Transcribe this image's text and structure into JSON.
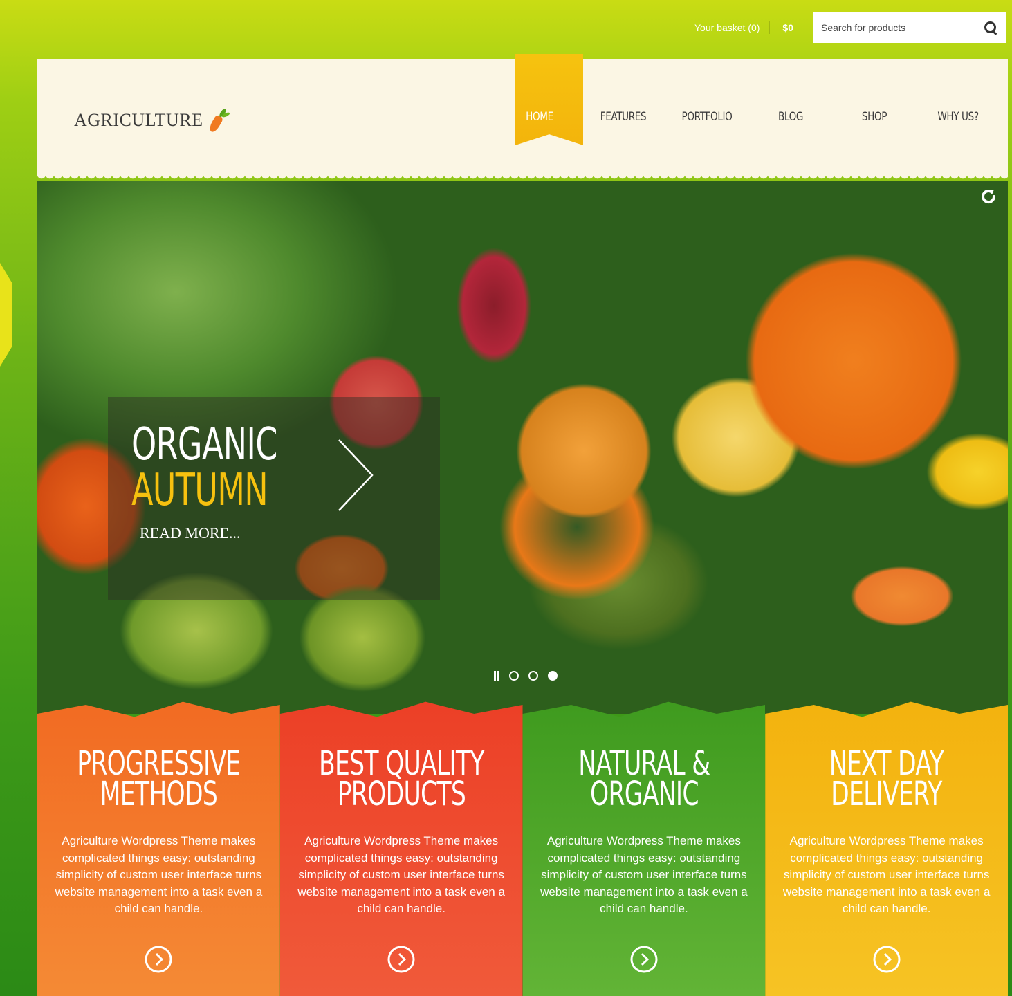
{
  "topbar": {
    "basket_label": "Your basket (0)",
    "basket_total": "$0",
    "search_placeholder": "Search for products",
    "search_icon": "search-icon"
  },
  "header": {
    "logo_text": "AGRICULTURE",
    "logo_icon": "carrot-icon",
    "nav": [
      "HOME",
      "FEATURES",
      "PORTFOLIO",
      "BLOG",
      "SHOP",
      "WHY US?"
    ],
    "active_nav": "HOME"
  },
  "slider": {
    "title_line1": "ORGANIC",
    "title_line2": "AUTUMN",
    "read_more": "READ MORE...",
    "slide_count": 3,
    "active_slide": 3
  },
  "features": [
    {
      "title_line1": "PROGRESSIVE",
      "title_line2": "METHODS",
      "text": "Agriculture Wordpress Theme makes complicated things easy: outstanding simplicity of custom user interface turns website management into a task even a child can handle."
    },
    {
      "title_line1": "BEST QUALITY",
      "title_line2": "PRODUCTS",
      "text": "Agriculture Wordpress Theme makes complicated things easy: outstanding simplicity of custom user interface turns website management into a task even a child can handle."
    },
    {
      "title_line1": "NATURAL &",
      "title_line2": "ORGANIC",
      "text": "Agriculture Wordpress Theme makes complicated things easy: outstanding simplicity of custom user interface turns website management into a task even a child can handle."
    },
    {
      "title_line1": "NEXT DAY",
      "title_line2": "DELIVERY",
      "text": "Agriculture Wordpress Theme makes complicated things easy: outstanding simplicity of custom user interface turns website management into a task even a child can handle."
    }
  ],
  "colors": {
    "accent_yellow": "#f6c10f",
    "orange": "#f26a22",
    "red": "#ec3f26",
    "green": "#3e9a1e",
    "header_bg": "#fbf6e4"
  }
}
